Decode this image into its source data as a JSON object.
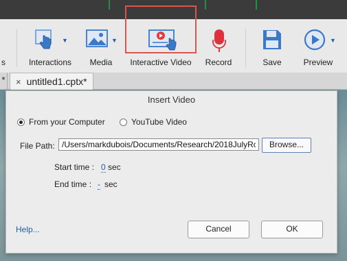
{
  "toolbar": {
    "items": [
      {
        "label": "Interactions",
        "icon": "hand-pointer-icon"
      },
      {
        "label": "Media",
        "icon": "image-icon"
      },
      {
        "label": "Interactive Video",
        "icon": "interactive-video-icon"
      },
      {
        "label": "Record",
        "icon": "microphone-icon"
      },
      {
        "label": "Save",
        "icon": "floppy-disk-icon"
      },
      {
        "label": "Preview",
        "icon": "play-circle-icon"
      }
    ],
    "highlight_color": "#d9534f",
    "accent_color": "#1e5fa8"
  },
  "tabs": {
    "edge_label": "*",
    "active": {
      "close": "×",
      "label": "untitled1.cptx*"
    }
  },
  "dialog": {
    "title": "Insert Video",
    "source_options": [
      {
        "label": "From your Computer",
        "selected": true
      },
      {
        "label": "YouTube Video",
        "selected": false
      }
    ],
    "file_path_label": "File Path:",
    "file_path_value": "/Users/markdubois/Documents/Research/2018JulyRc",
    "browse_label": "Browse...",
    "start_time": {
      "label": "Start time :",
      "value": "0",
      "unit": "sec"
    },
    "end_time": {
      "label": "End time :",
      "value": "-",
      "unit": "sec"
    },
    "help_label": "Help...",
    "cancel_label": "Cancel",
    "ok_label": "OK"
  }
}
